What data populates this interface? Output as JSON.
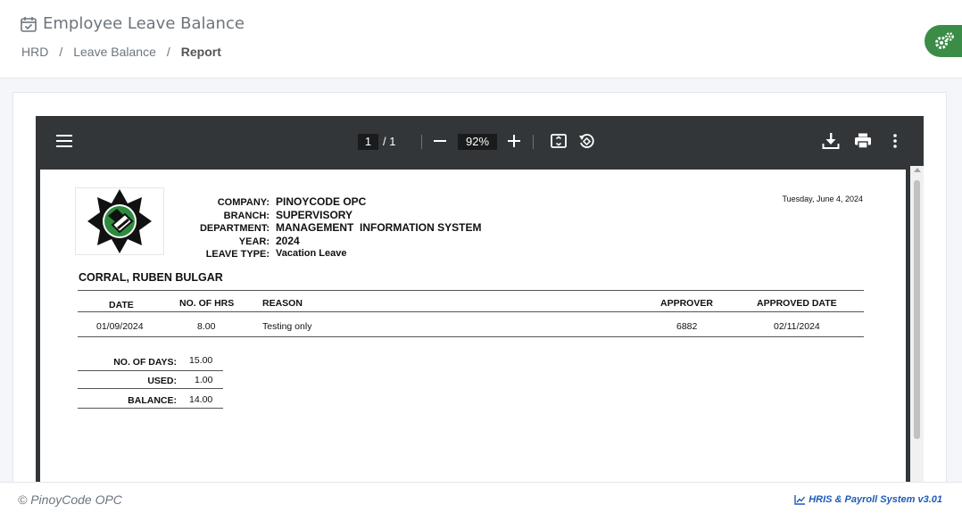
{
  "header": {
    "title": "Employee Leave Balance",
    "breadcrumb": [
      "HRD",
      "Leave Balance",
      "Report"
    ],
    "separator": "/"
  },
  "pdf_toolbar": {
    "page_current": "1",
    "page_total": "/ 1",
    "zoom": "92%"
  },
  "report": {
    "header_labels": [
      "COMPANY:",
      "BRANCH:",
      "DEPARTMENT:",
      "YEAR:",
      "LEAVE TYPE:"
    ],
    "header_values": [
      "PINOYCODE OPC",
      "SUPERVISORY",
      "MANAGEMENT  INFORMATION SYSTEM",
      "2024",
      "Vacation Leave"
    ],
    "date": "Tuesday, June 4, 2024",
    "employee_name": "CORRAL, RUBEN BULGAR",
    "columns": [
      "DATE",
      "NO. OF HRS",
      "REASON",
      "APPROVER",
      "APPROVED DATE"
    ],
    "rows": [
      {
        "date": "01/09/2024",
        "hrs": "8.00",
        "reason": "Testing only",
        "approver": "6882",
        "approved_date": "02/11/2024"
      }
    ],
    "summary": {
      "days_label": "NO. OF DAYS:",
      "days_value": "15.00",
      "used_label": "USED:",
      "used_value": "1.00",
      "balance_label": "BALANCE:",
      "balance_value": "14.00"
    }
  },
  "footer": {
    "copyright": "© PinoyCode OPC",
    "version": "HRIS & Payroll System v3.01"
  },
  "colors": {
    "accent_green": "#3a8c46",
    "viewer_dark": "#323639",
    "link_blue": "#1e5bb8"
  }
}
